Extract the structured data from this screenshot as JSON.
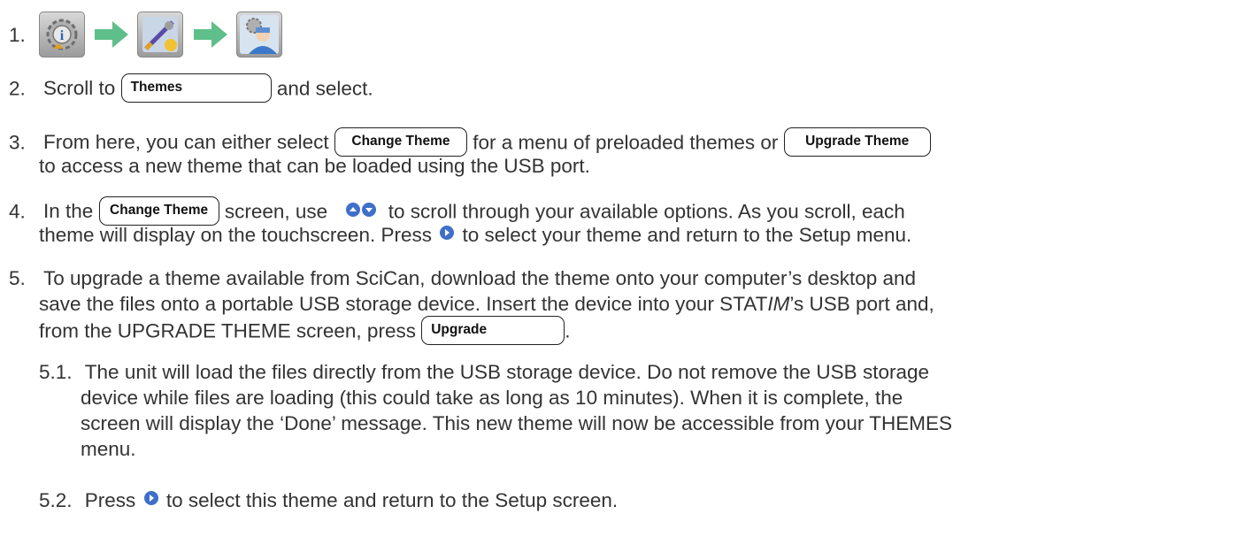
{
  "steps": {
    "s1": {
      "num": "1."
    },
    "s2": {
      "num": "2.",
      "pre": "Scroll to",
      "button": "Themes",
      "post": "and select."
    },
    "s3": {
      "num": "3.",
      "pre": "From here, you can either select",
      "button1": "Change Theme",
      "mid": "for a menu of preloaded themes or",
      "button2": "Upgrade Theme",
      "line2": "to access a new theme that can be loaded using the USB port."
    },
    "s4": {
      "num": "4.",
      "pre": "In the",
      "button": "Change Theme",
      "mid": "screen, use",
      "post": "to scroll through your available options. As you scroll, each",
      "line2_pre": "theme will display on the touchscreen. Press",
      "line2_post": "to select your theme and return to the Setup menu."
    },
    "s5": {
      "num": "5.",
      "line1": "To upgrade a theme available from SciCan, download the theme onto your computer’s desktop and",
      "line2_pre": "save the files onto a portable USB storage device. Insert the device into your STAT",
      "line2_ital": "IM",
      "line2_post": "’s USB port and,",
      "line3_pre": "from the UPGRADE THEME screen, press",
      "button": "Upgrade",
      "line3_post": "."
    },
    "s51": {
      "num": "5.1.",
      "line1": "The unit will load the files directly from the USB storage device. Do not remove the USB storage",
      "line2": "device while files are loading (this could take as long as 10 minutes). When it is complete, the",
      "line3": "screen will display the ‘Done’ message. This new theme will now be accessible from your THEMES",
      "line4": "menu."
    },
    "s52": {
      "num": "5.2.",
      "pre": "Press",
      "post": "to select this theme and return to the Setup screen."
    }
  },
  "icons": [
    "settings-info-gear-icon",
    "theme-paint-icon",
    "setup-user-gear-icon",
    "scroll-up-down-icon",
    "select-next-icon"
  ],
  "colors": {
    "arrow": "#5fbf8a",
    "nav_blue": "#3f6fc9",
    "text": "#333333"
  }
}
